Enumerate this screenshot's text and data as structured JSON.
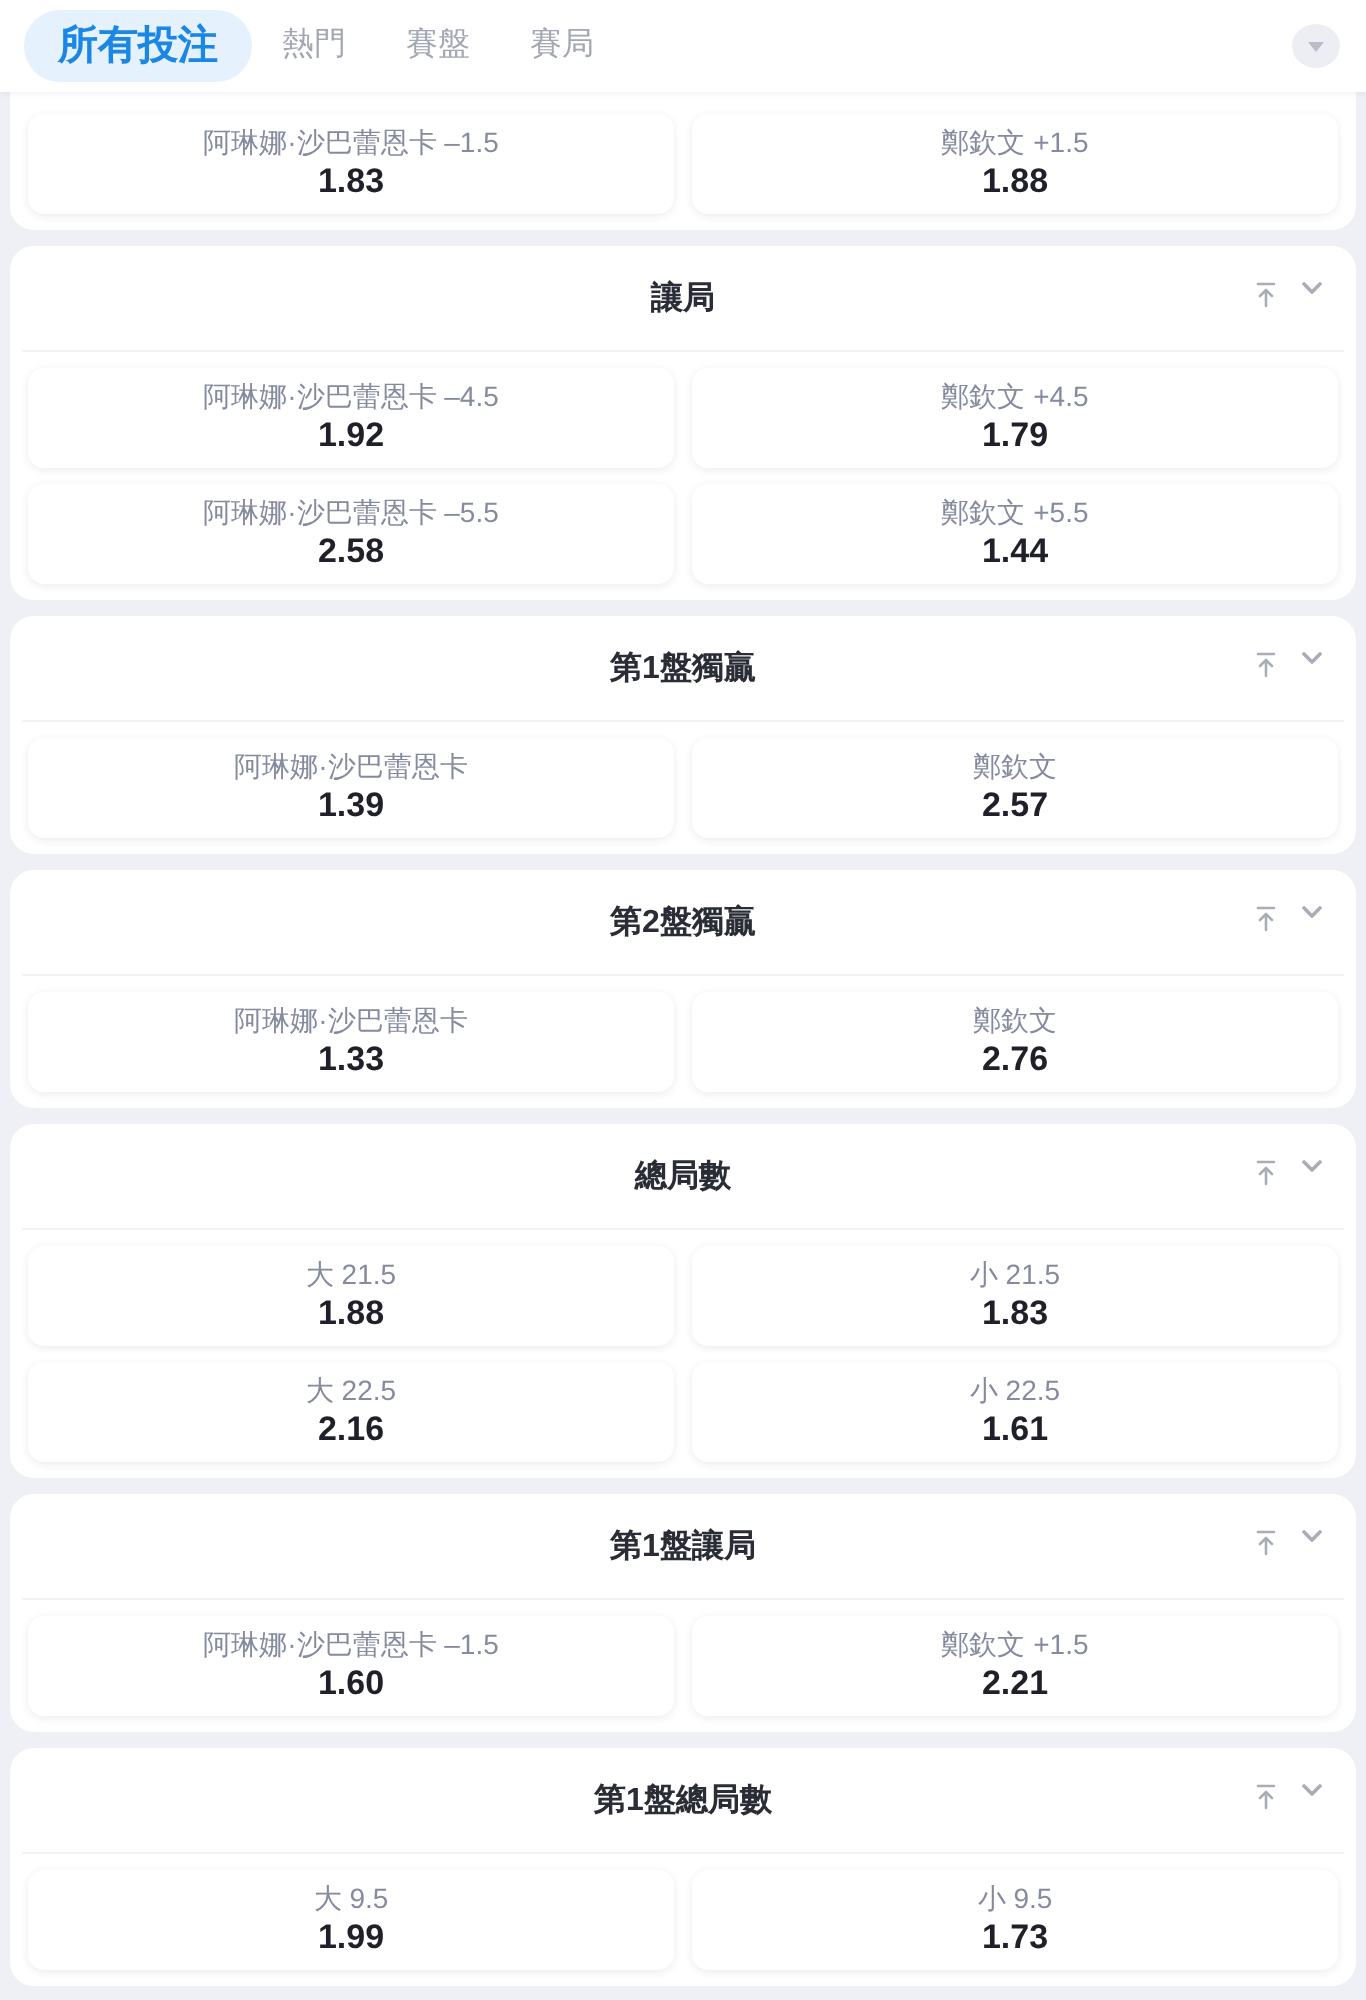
{
  "tabs": [
    {
      "label": "所有投注",
      "selected": true
    },
    {
      "label": "熱門",
      "selected": false
    },
    {
      "label": "賽盤",
      "selected": false
    },
    {
      "label": "賽局",
      "selected": false
    }
  ],
  "markets": [
    {
      "outcomes": [
        {
          "label": "阿琳娜·沙巴蕾恩卡 –1.5",
          "odds": "1.83"
        },
        {
          "label": "鄭欽文 +1.5",
          "odds": "1.88"
        }
      ]
    },
    {
      "title": "讓局",
      "outcomes": [
        {
          "label": "阿琳娜·沙巴蕾恩卡 –4.5",
          "odds": "1.92"
        },
        {
          "label": "鄭欽文 +4.5",
          "odds": "1.79"
        },
        {
          "label": "阿琳娜·沙巴蕾恩卡 –5.5",
          "odds": "2.58"
        },
        {
          "label": "鄭欽文 +5.5",
          "odds": "1.44"
        }
      ]
    },
    {
      "title": "第1盤獨贏",
      "outcomes": [
        {
          "label": "阿琳娜·沙巴蕾恩卡",
          "odds": "1.39"
        },
        {
          "label": "鄭欽文",
          "odds": "2.57"
        }
      ]
    },
    {
      "title": "第2盤獨贏",
      "outcomes": [
        {
          "label": "阿琳娜·沙巴蕾恩卡",
          "odds": "1.33"
        },
        {
          "label": "鄭欽文",
          "odds": "2.76"
        }
      ]
    },
    {
      "title": "總局數",
      "outcomes": [
        {
          "label": "大 21.5",
          "odds": "1.88"
        },
        {
          "label": "小 21.5",
          "odds": "1.83"
        },
        {
          "label": "大 22.5",
          "odds": "2.16"
        },
        {
          "label": "小 22.5",
          "odds": "1.61"
        }
      ]
    },
    {
      "title": "第1盤讓局",
      "outcomes": [
        {
          "label": "阿琳娜·沙巴蕾恩卡 –1.5",
          "odds": "1.60"
        },
        {
          "label": "鄭欽文 +1.5",
          "odds": "2.21"
        }
      ]
    },
    {
      "title": "第1盤總局數",
      "outcomes": [
        {
          "label": "大 9.5",
          "odds": "1.99"
        },
        {
          "label": "小 9.5",
          "odds": "1.73"
        }
      ]
    }
  ]
}
